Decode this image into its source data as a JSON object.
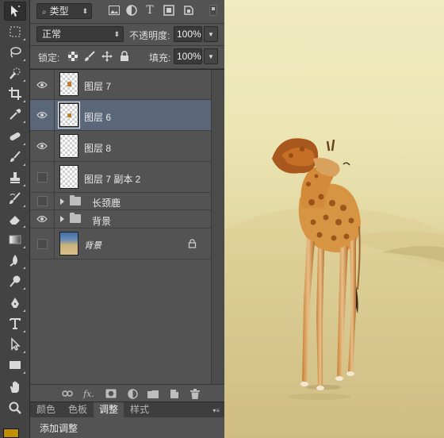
{
  "filter_bar": {
    "kind_label": "类型",
    "icons": [
      "image-filter-icon",
      "adjustment-filter-icon",
      "type-filter-icon",
      "shape-filter-icon",
      "smart-object-filter-icon"
    ]
  },
  "blend_bar": {
    "blend_mode": "正常",
    "opacity_label": "不透明度:",
    "opacity_value": "100%"
  },
  "lock_bar": {
    "lock_label": "锁定:",
    "fill_label": "填充:",
    "fill_value": "100%"
  },
  "layers": [
    {
      "name": "图层 7",
      "visible": true,
      "selected": false,
      "kind": "pixel"
    },
    {
      "name": "图层 6",
      "visible": true,
      "selected": true,
      "kind": "pixel"
    },
    {
      "name": "图层 8",
      "visible": true,
      "selected": false,
      "kind": "pixel"
    },
    {
      "name": "图层 7 副本 2",
      "visible": false,
      "selected": false,
      "kind": "pixel"
    },
    {
      "name": "长颈鹿",
      "visible": false,
      "selected": false,
      "kind": "group"
    },
    {
      "name": "背景",
      "visible": true,
      "selected": false,
      "kind": "group"
    },
    {
      "name": "背景",
      "visible": false,
      "selected": false,
      "kind": "background",
      "locked": true
    }
  ],
  "layer_actions": [
    "link-layers-icon",
    "fx-icon",
    "mask-icon",
    "adjustment-layer-icon",
    "group-folder-icon",
    "new-layer-icon",
    "delete-layer-icon"
  ],
  "fx_label": "fx.",
  "tabs": [
    {
      "label": "颜色",
      "active": false
    },
    {
      "label": "色板",
      "active": false
    },
    {
      "label": "调整",
      "active": true
    },
    {
      "label": "样式",
      "active": false
    }
  ],
  "adjust_panel": {
    "title": "添加调整"
  },
  "colors": {
    "foreground": "#c09000",
    "selection": "#596779",
    "panel": "#535353"
  }
}
